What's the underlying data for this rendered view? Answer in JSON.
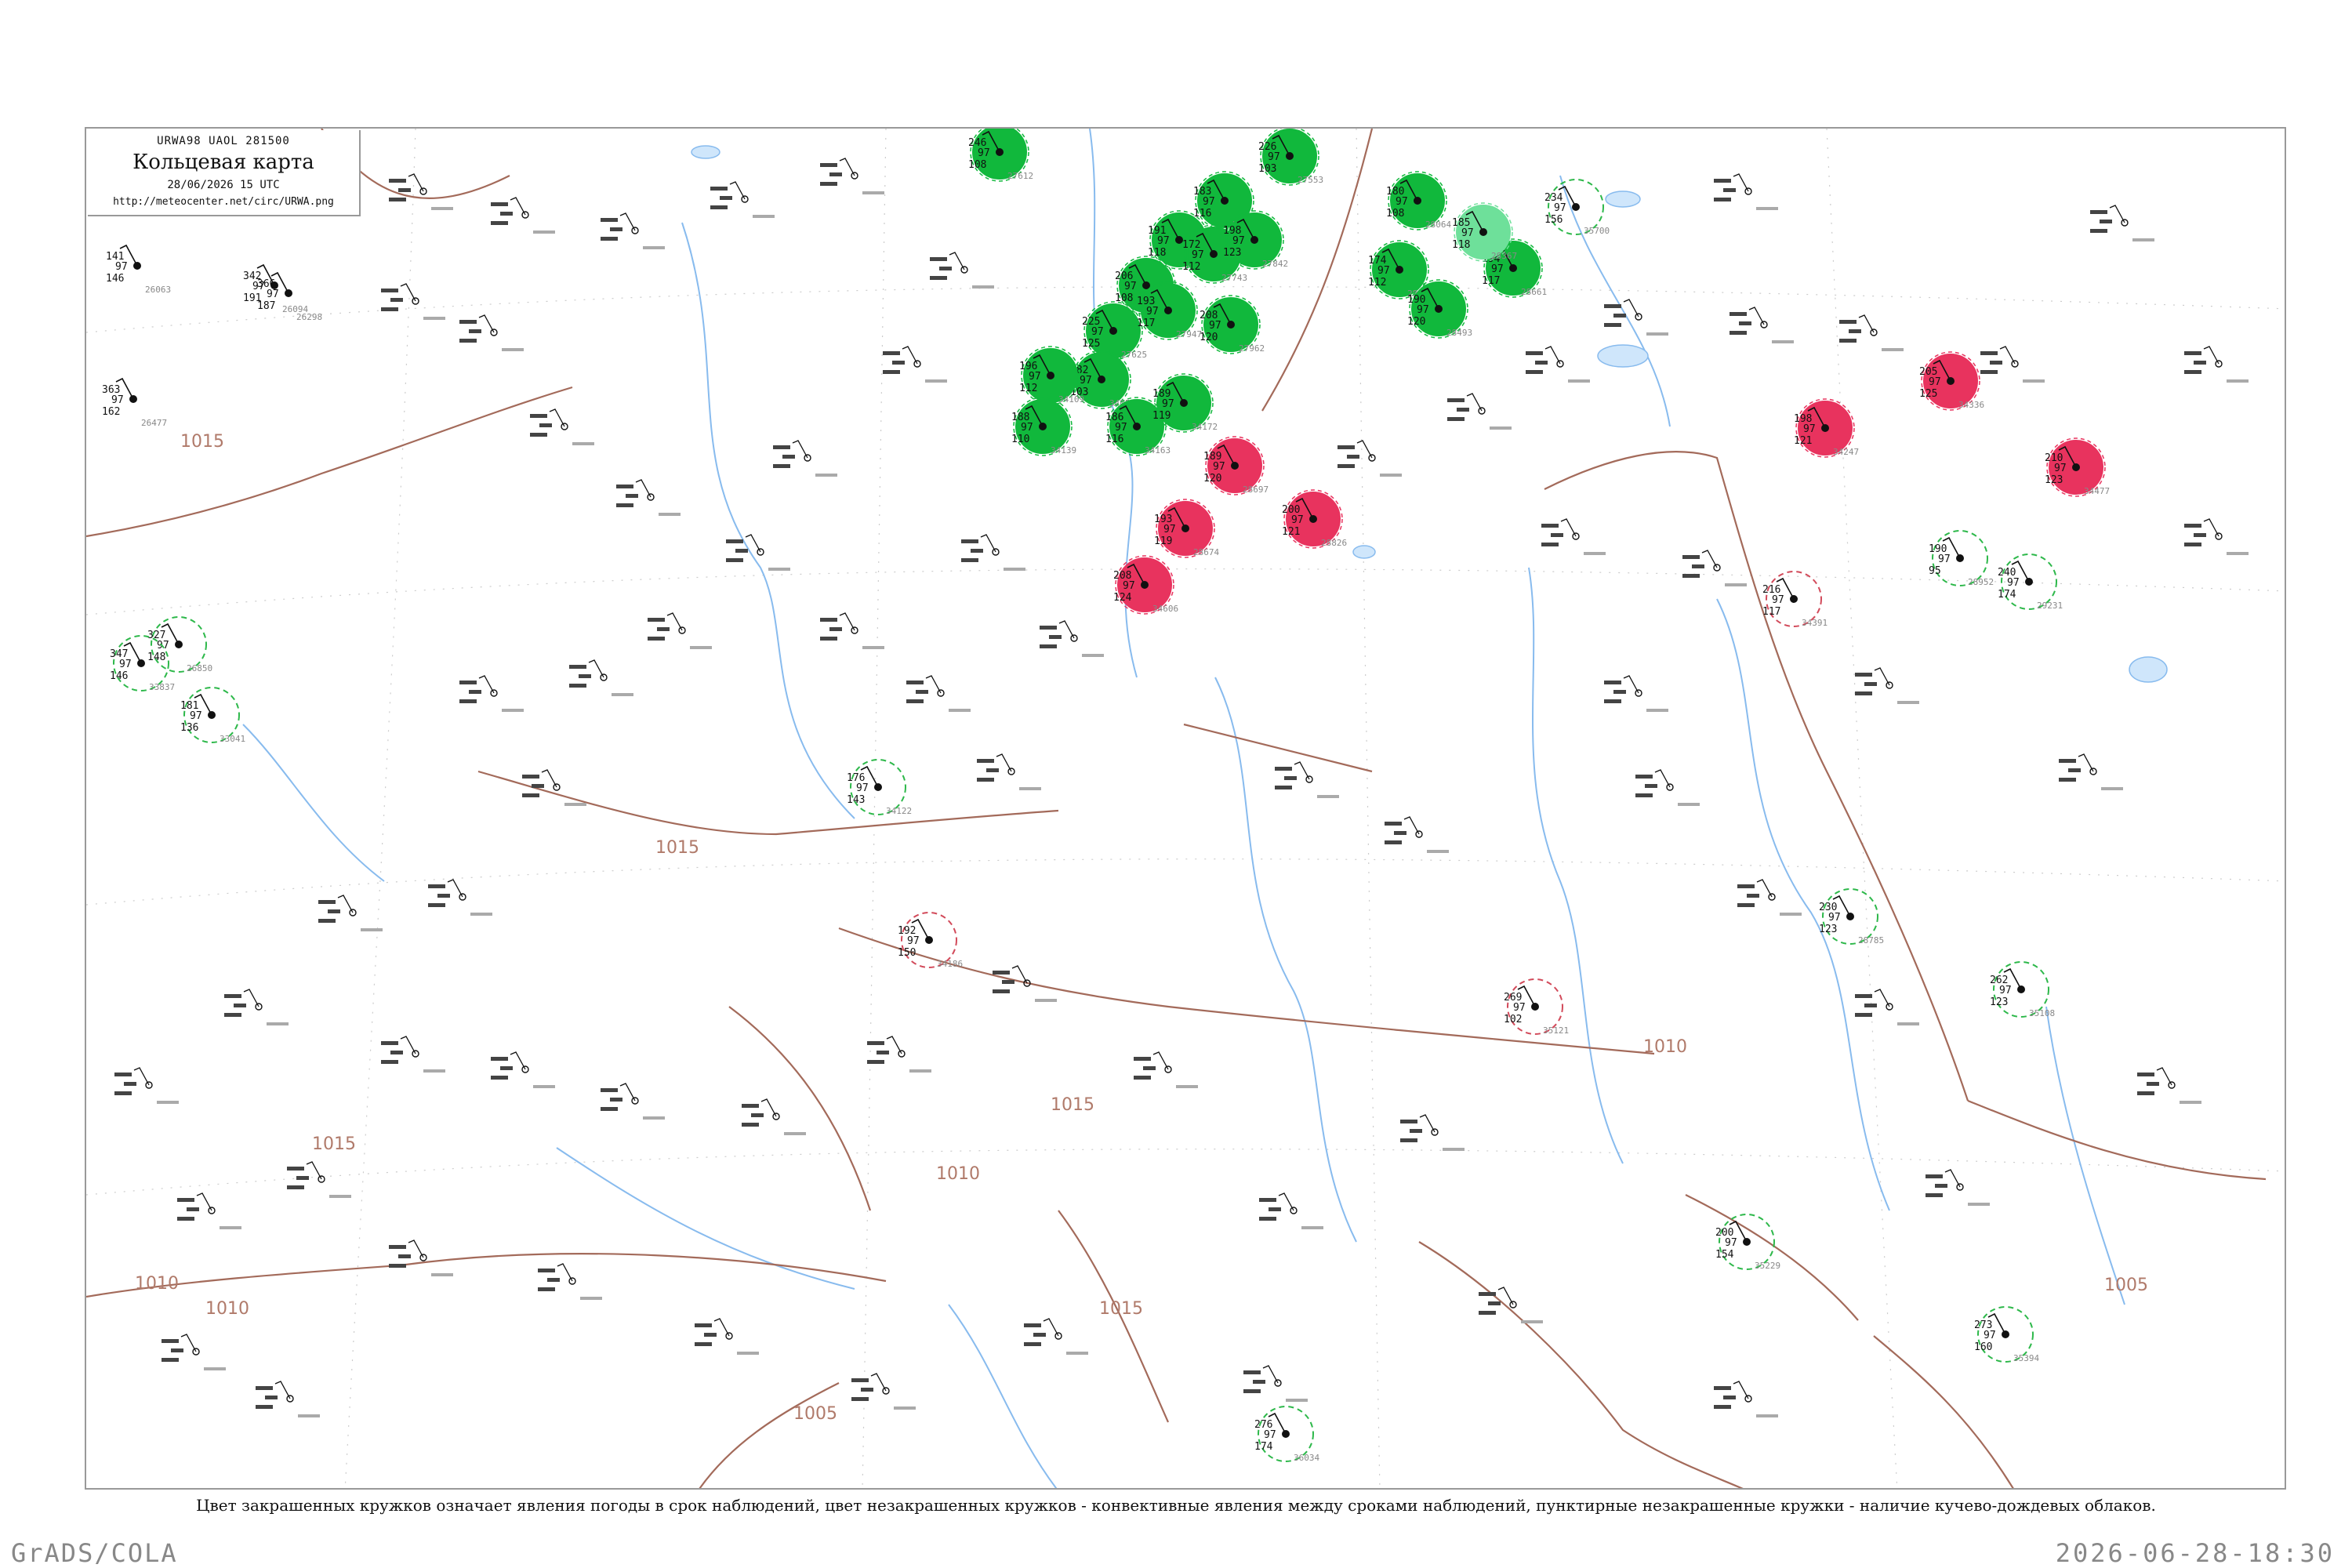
{
  "legend": {
    "code": "URWA98  UAOL  281500",
    "title": "Кольцевая карта",
    "date": "28/06/2026 15 UTC",
    "url": "http://meteocenter.net/circ/URWA.png"
  },
  "caption": "Цвет закрашенных кружков означает явления погоды в срок наблюдений, цвет незакрашенных кружков - конвективные явления между сроками наблюдений, пунктирные незакрашенные кружки - наличие кучево-дождевых облаков.",
  "footer": {
    "left": "GrADS/COLA",
    "right": "2026-06-28-18:30"
  },
  "colors": {
    "green_fill": "#11b83c",
    "light_green_fill": "#6ee09a",
    "red_fill": "#e8335e",
    "green_ring": "#2db84a",
    "red_ring": "#d24a5a",
    "isobar": "#a36a5a",
    "river": "#88bbee"
  },
  "isobars": {
    "labels": [
      "1015",
      "1010",
      "1015",
      "1010",
      "1015",
      "1010",
      "1005",
      "1005",
      "1015",
      "1010",
      "1015"
    ]
  },
  "stations": [
    {
      "id": "27612",
      "t": "246",
      "p": "97",
      "d": "108",
      "marker": "green-filled"
    },
    {
      "id": "27553",
      "t": "226",
      "p": "97",
      "d": "103",
      "marker": "green-filled"
    },
    {
      "id": "27719",
      "t": "183",
      "p": "97",
      "d": "116",
      "marker": "green-filled"
    },
    {
      "id": "27731",
      "t": "191",
      "p": "97",
      "d": "118",
      "marker": "green-filled"
    },
    {
      "id": "27743",
      "t": "172",
      "p": "97",
      "d": "112",
      "marker": "green-filled"
    },
    {
      "id": "27458",
      "t": "206",
      "p": "97",
      "d": "108",
      "marker": "green-filled"
    },
    {
      "id": "27625",
      "t": "225",
      "p": "97",
      "d": "125",
      "marker": "green-filled"
    },
    {
      "id": "27842",
      "t": "198",
      "p": "97",
      "d": "123",
      "marker": "green-filled"
    },
    {
      "id": "27947",
      "t": "193",
      "p": "97",
      "d": "117",
      "marker": "green-filled"
    },
    {
      "id": "27962",
      "t": "208",
      "p": "97",
      "d": "120",
      "marker": "green-filled"
    },
    {
      "id": "34056",
      "t": "182",
      "p": "97",
      "d": "103",
      "marker": "green-filled"
    },
    {
      "id": "34109",
      "t": "196",
      "p": "97",
      "d": "112",
      "marker": "green-filled"
    },
    {
      "id": "34139",
      "t": "188",
      "p": "97",
      "d": "110",
      "marker": "green-filled"
    },
    {
      "id": "34163",
      "t": "186",
      "p": "97",
      "d": "116",
      "marker": "green-filled"
    },
    {
      "id": "34172",
      "t": "189",
      "p": "97",
      "d": "119",
      "marker": "green-filled"
    },
    {
      "id": "28064",
      "t": "180",
      "p": "97",
      "d": "108",
      "marker": "green-filled"
    },
    {
      "id": "28275",
      "t": "174",
      "p": "97",
      "d": "112",
      "marker": "green-filled"
    },
    {
      "id": "28493",
      "t": "190",
      "p": "97",
      "d": "120",
      "marker": "green-filled"
    },
    {
      "id": "28661",
      "t": "194",
      "p": "97",
      "d": "117",
      "marker": "green-filled"
    },
    {
      "id": "28367",
      "t": "185",
      "p": "97",
      "d": "118",
      "marker": "light-green-filled"
    },
    {
      "id": "34247",
      "t": "198",
      "p": "97",
      "d": "121",
      "marker": "red-filled"
    },
    {
      "id": "34336",
      "t": "205",
      "p": "97",
      "d": "125",
      "marker": "red-filled"
    },
    {
      "id": "34477",
      "t": "210",
      "p": "97",
      "d": "123",
      "marker": "red-filled"
    },
    {
      "id": "28674",
      "t": "193",
      "p": "97",
      "d": "119",
      "marker": "red-filled"
    },
    {
      "id": "28697",
      "t": "189",
      "p": "97",
      "d": "120",
      "marker": "red-filled"
    },
    {
      "id": "28826",
      "t": "200",
      "p": "97",
      "d": "121",
      "marker": "red-filled"
    },
    {
      "id": "34606",
      "t": "208",
      "p": "97",
      "d": "124",
      "marker": "red-filled"
    },
    {
      "id": "26063",
      "t": "141",
      "p": "97",
      "d": "146",
      "marker": "none"
    },
    {
      "id": "26094",
      "t": "342",
      "p": "97",
      "d": "191",
      "marker": "none"
    },
    {
      "id": "26298",
      "t": "366",
      "p": "97",
      "d": "187",
      "marker": "none"
    },
    {
      "id": "26477",
      "t": "363",
      "p": "97",
      "d": "162",
      "marker": "none"
    },
    {
      "id": "26850",
      "t": "327",
      "p": "97",
      "d": "148",
      "marker": "green-ring"
    },
    {
      "id": "33837",
      "t": "347",
      "p": "97",
      "d": "146",
      "marker": "green-ring"
    },
    {
      "id": "33041",
      "t": "181",
      "p": "97",
      "d": "136",
      "marker": "green-ring"
    },
    {
      "id": "34122",
      "t": "176",
      "p": "97",
      "d": "143",
      "marker": "green-ring"
    },
    {
      "id": "34186",
      "t": "192",
      "p": "97",
      "d": "150",
      "marker": "red-ring"
    },
    {
      "id": "34391",
      "t": "216",
      "p": "97",
      "d": "117",
      "marker": "red-ring"
    },
    {
      "id": "28952",
      "t": "190",
      "p": "97",
      "d": "95",
      "marker": "green-ring"
    },
    {
      "id": "29231",
      "t": "240",
      "p": "97",
      "d": "174",
      "marker": "green-ring"
    },
    {
      "id": "28785",
      "t": "230",
      "p": "97",
      "d": "123",
      "marker": "green-ring"
    },
    {
      "id": "35108",
      "t": "262",
      "p": "97",
      "d": "123",
      "marker": "green-ring"
    },
    {
      "id": "35121",
      "t": "269",
      "p": "97",
      "d": "102",
      "marker": "red-ring"
    },
    {
      "id": "35229",
      "t": "200",
      "p": "97",
      "d": "154",
      "marker": "green-ring"
    },
    {
      "id": "35394",
      "t": "273",
      "p": "97",
      "d": "160",
      "marker": "green-ring"
    },
    {
      "id": "36034",
      "t": "276",
      "p": "97",
      "d": "174",
      "marker": "green-ring"
    },
    {
      "id": "35700",
      "t": "234",
      "p": "97",
      "d": "156",
      "marker": "green-ring"
    }
  ]
}
